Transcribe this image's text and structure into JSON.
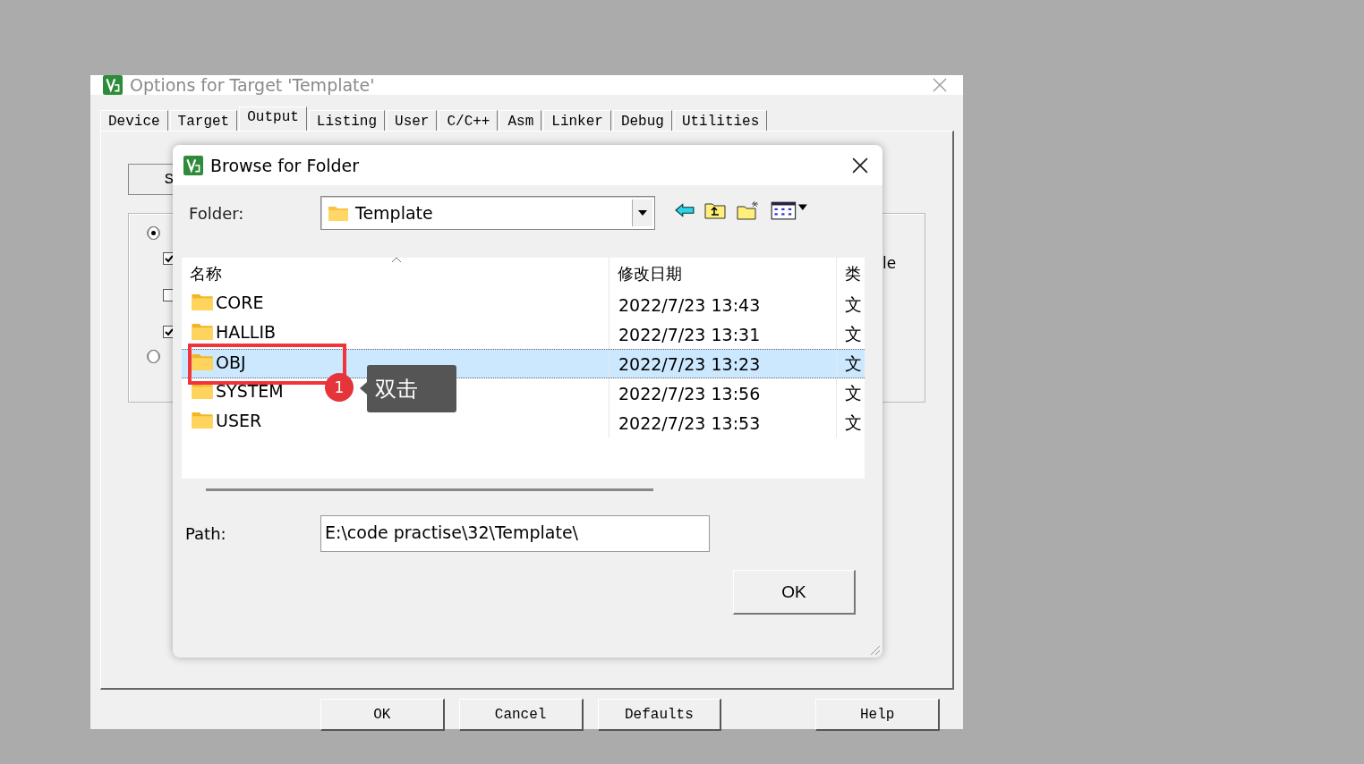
{
  "back_window": {
    "title": "Options for Target 'Template'",
    "tabs": [
      {
        "label": "Device",
        "selected": false
      },
      {
        "label": "Target",
        "selected": false
      },
      {
        "label": "Output",
        "selected": true
      },
      {
        "label": "Listing",
        "selected": false
      },
      {
        "label": "User",
        "selected": false
      },
      {
        "label": "C/C++",
        "selected": false
      },
      {
        "label": "Asm",
        "selected": false
      },
      {
        "label": "Linker",
        "selected": false
      },
      {
        "label": "Debug",
        "selected": false
      },
      {
        "label": "Utilities",
        "selected": false
      }
    ],
    "side_button": "S",
    "options": [
      {
        "kind": "radio",
        "checked": true
      },
      {
        "kind": "checkbox",
        "checked": true
      },
      {
        "kind": "checkbox",
        "checked": false
      },
      {
        "kind": "checkbox",
        "checked": true
      },
      {
        "kind": "radio",
        "checked": false
      }
    ],
    "partial_label": "le",
    "buttons": [
      "OK",
      "Cancel",
      "Defaults",
      "Help"
    ]
  },
  "dialog": {
    "title": "Browse for Folder",
    "folder_label": "Folder:",
    "folder_value": "Template",
    "columns": [
      "名称",
      "修改日期",
      "类"
    ],
    "rows": [
      {
        "name": "CORE",
        "date": "2022/7/23 13:43",
        "type": "文",
        "selected": false
      },
      {
        "name": "HALLIB",
        "date": "2022/7/23 13:31",
        "type": "文",
        "selected": false
      },
      {
        "name": "OBJ",
        "date": "2022/7/23 13:23",
        "type": "文",
        "selected": true
      },
      {
        "name": "SYSTEM",
        "date": "2022/7/23 13:56",
        "type": "文",
        "selected": false
      },
      {
        "name": "USER",
        "date": "2022/7/23 13:53",
        "type": "文",
        "selected": false
      }
    ],
    "path_label": "Path:",
    "path_value": "E:\\code practise\\32\\Template\\",
    "ok": "OK"
  },
  "annotation": {
    "badge": "1",
    "tooltip": "双击"
  }
}
